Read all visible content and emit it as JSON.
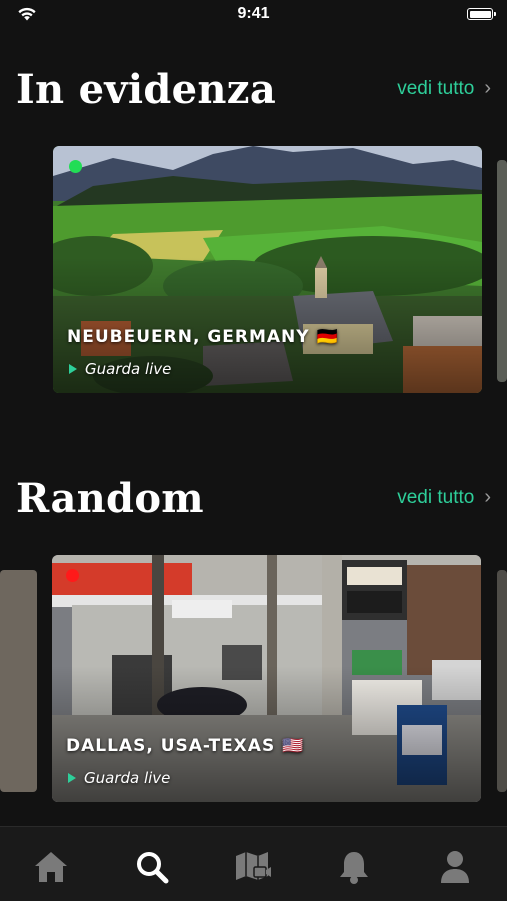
{
  "status_bar": {
    "time": "9:41"
  },
  "sections": [
    {
      "title": "In evidenza",
      "see_all_label": "vedi tutto",
      "card": {
        "place": "NEUBEUERN, GERMANY",
        "flag": "🇩🇪",
        "watch_label": "Guarda live",
        "live_dot_color": "#22dd55"
      }
    },
    {
      "title": "Random",
      "see_all_label": "vedi tutto",
      "card": {
        "place": "DALLAS, USA-TEXAS",
        "flag": "🇺🇸",
        "watch_label": "Guarda live",
        "live_dot_color": "#ff1a1a"
      }
    }
  ],
  "tab_bar": {
    "items": [
      {
        "icon": "home-icon",
        "active": false
      },
      {
        "icon": "search-icon",
        "active": true
      },
      {
        "icon": "map-camera-icon",
        "active": false
      },
      {
        "icon": "bell-icon",
        "active": false
      },
      {
        "icon": "profile-icon",
        "active": false
      }
    ]
  },
  "colors": {
    "accent": "#2ecf9a",
    "background": "#121212",
    "tab_active": "#ffffff",
    "tab_inactive": "#7a7a7a"
  }
}
